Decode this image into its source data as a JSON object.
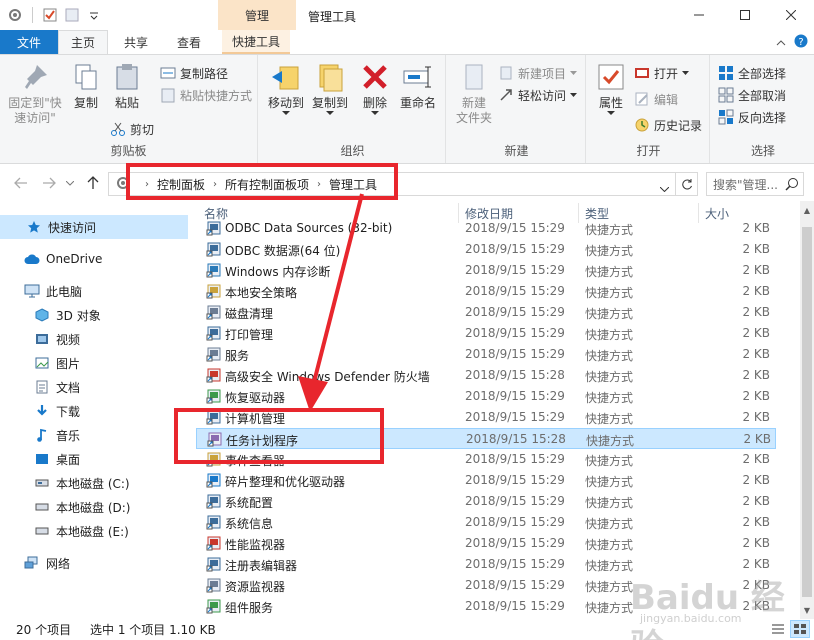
{
  "window": {
    "title": "管理工具",
    "context_group": "管理"
  },
  "tabs": {
    "file": "文件",
    "home": "主页",
    "share": "共享",
    "view": "查看",
    "shortcut_tools": "快捷工具"
  },
  "ribbon": {
    "clipboard": {
      "label": "剪贴板",
      "pin": "固定到\"快\n速访问\"",
      "copy": "复制",
      "paste": "粘贴",
      "copy_path": "复制路径",
      "paste_shortcut": "粘贴快捷方式",
      "cut": "剪切"
    },
    "organize": {
      "label": "组织",
      "move_to": "移动到",
      "copy_to": "复制到",
      "delete": "删除",
      "rename": "重命名"
    },
    "new": {
      "label": "新建",
      "new_folder": "新建\n文件夹",
      "new_item": "新建项目",
      "easy_access": "轻松访问"
    },
    "open": {
      "label": "打开",
      "properties": "属性",
      "open": "打开",
      "edit": "编辑",
      "history": "历史记录"
    },
    "select": {
      "label": "选择",
      "select_all": "全部选择",
      "select_none": "全部取消",
      "invert": "反向选择"
    }
  },
  "address": {
    "crumbs": [
      "控制面板",
      "所有控制面板项",
      "管理工具"
    ],
    "search_placeholder": "搜索\"管理..."
  },
  "navpane": {
    "items": [
      {
        "label": "快速访问",
        "icon": "star-icon"
      },
      {
        "label": "OneDrive",
        "icon": "cloud-icon"
      },
      {
        "label": "此电脑",
        "icon": "computer-icon"
      },
      {
        "label": "3D 对象",
        "icon": "cube-icon"
      },
      {
        "label": "视频",
        "icon": "video-icon"
      },
      {
        "label": "图片",
        "icon": "picture-icon"
      },
      {
        "label": "文档",
        "icon": "document-icon"
      },
      {
        "label": "下载",
        "icon": "download-icon"
      },
      {
        "label": "音乐",
        "icon": "music-icon"
      },
      {
        "label": "桌面",
        "icon": "desktop-icon"
      },
      {
        "label": "本地磁盘 (C:)",
        "icon": "drive-icon"
      },
      {
        "label": "本地磁盘 (D:)",
        "icon": "drive-icon"
      },
      {
        "label": "本地磁盘 (E:)",
        "icon": "drive-icon"
      },
      {
        "label": "网络",
        "icon": "network-icon"
      }
    ]
  },
  "filelist": {
    "columns": {
      "name": "名称",
      "date": "修改日期",
      "type": "类型",
      "size": "大小"
    },
    "rows": [
      {
        "name": "ODBC Data Sources (32-bit)",
        "date": "2018/9/15 15:29",
        "type": "快捷方式",
        "size": "2 KB"
      },
      {
        "name": "ODBC 数据源(64 位)",
        "date": "2018/9/15 15:29",
        "type": "快捷方式",
        "size": "2 KB"
      },
      {
        "name": "Windows 内存诊断",
        "date": "2018/9/15 15:29",
        "type": "快捷方式",
        "size": "2 KB"
      },
      {
        "name": "本地安全策略",
        "date": "2018/9/15 15:29",
        "type": "快捷方式",
        "size": "2 KB"
      },
      {
        "name": "磁盘清理",
        "date": "2018/9/15 15:29",
        "type": "快捷方式",
        "size": "2 KB"
      },
      {
        "name": "打印管理",
        "date": "2018/9/15 15:29",
        "type": "快捷方式",
        "size": "2 KB"
      },
      {
        "name": "服务",
        "date": "2018/9/15 15:29",
        "type": "快捷方式",
        "size": "2 KB"
      },
      {
        "name": "高级安全 Windows Defender 防火墙",
        "date": "2018/9/15 15:28",
        "type": "快捷方式",
        "size": "2 KB"
      },
      {
        "name": "恢复驱动器",
        "date": "2018/9/15 15:29",
        "type": "快捷方式",
        "size": "2 KB"
      },
      {
        "name": "计算机管理",
        "date": "2018/9/15 15:29",
        "type": "快捷方式",
        "size": "2 KB"
      },
      {
        "name": "任务计划程序",
        "date": "2018/9/15 15:28",
        "type": "快捷方式",
        "size": "2 KB"
      },
      {
        "name": "事件查看器",
        "date": "2018/9/15 15:29",
        "type": "快捷方式",
        "size": "2 KB"
      },
      {
        "name": "碎片整理和优化驱动器",
        "date": "2018/9/15 15:29",
        "type": "快捷方式",
        "size": "2 KB"
      },
      {
        "name": "系统配置",
        "date": "2018/9/15 15:29",
        "type": "快捷方式",
        "size": "2 KB"
      },
      {
        "name": "系统信息",
        "date": "2018/9/15 15:29",
        "type": "快捷方式",
        "size": "2 KB"
      },
      {
        "name": "性能监视器",
        "date": "2018/9/15 15:29",
        "type": "快捷方式",
        "size": "2 KB"
      },
      {
        "name": "注册表编辑器",
        "date": "2018/9/15 15:29",
        "type": "快捷方式",
        "size": "2 KB"
      },
      {
        "name": "资源监视器",
        "date": "2018/9/15 15:29",
        "type": "快捷方式",
        "size": "2 KB"
      },
      {
        "name": "组件服务",
        "date": "2018/9/15 15:29",
        "type": "快捷方式",
        "size": "2 KB"
      }
    ]
  },
  "status": {
    "count": "20 个项目",
    "selection": "选中 1 个项目  1.10 KB"
  },
  "watermark": {
    "brand": "Baidu 经验",
    "url": "jingyan.baidu.com"
  },
  "colors": {
    "accent": "#1979ca",
    "selection": "#cce8ff",
    "annotation": "#e8262d",
    "context_tab": "#fbe4c8"
  }
}
